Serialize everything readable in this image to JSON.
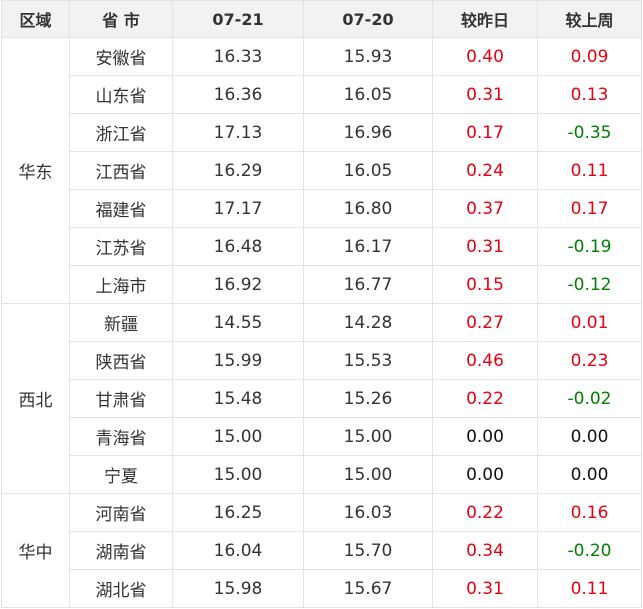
{
  "header": {
    "region": "区域",
    "province": "省 市",
    "date1": "07-21",
    "date2": "07-20",
    "vs_yesterday": "较昨日",
    "vs_last_week": "较上周"
  },
  "regions": [
    {
      "name": "华东",
      "rows": [
        {
          "province": "安徽省",
          "p1": "16.33",
          "p2": "15.93",
          "dd": "0.40",
          "dw": "0.09"
        },
        {
          "province": "山东省",
          "p1": "16.36",
          "p2": "16.05",
          "dd": "0.31",
          "dw": "0.13"
        },
        {
          "province": "浙江省",
          "p1": "17.13",
          "p2": "16.96",
          "dd": "0.17",
          "dw": "-0.35"
        },
        {
          "province": "江西省",
          "p1": "16.29",
          "p2": "16.05",
          "dd": "0.24",
          "dw": "0.11"
        },
        {
          "province": "福建省",
          "p1": "17.17",
          "p2": "16.80",
          "dd": "0.37",
          "dw": "0.17"
        },
        {
          "province": "江苏省",
          "p1": "16.48",
          "p2": "16.17",
          "dd": "0.31",
          "dw": "-0.19"
        },
        {
          "province": "上海市",
          "p1": "16.92",
          "p2": "16.77",
          "dd": "0.15",
          "dw": "-0.12"
        }
      ]
    },
    {
      "name": "西北",
      "rows": [
        {
          "province": "新疆",
          "p1": "14.55",
          "p2": "14.28",
          "dd": "0.27",
          "dw": "0.01"
        },
        {
          "province": "陕西省",
          "p1": "15.99",
          "p2": "15.53",
          "dd": "0.46",
          "dw": "0.23"
        },
        {
          "province": "甘肃省",
          "p1": "15.48",
          "p2": "15.26",
          "dd": "0.22",
          "dw": "-0.02"
        },
        {
          "province": "青海省",
          "p1": "15.00",
          "p2": "15.00",
          "dd": "0.00",
          "dw": "0.00"
        },
        {
          "province": "宁夏",
          "p1": "15.00",
          "p2": "15.00",
          "dd": "0.00",
          "dw": "0.00"
        }
      ]
    },
    {
      "name": "华中",
      "rows": [
        {
          "province": "河南省",
          "p1": "16.25",
          "p2": "16.03",
          "dd": "0.22",
          "dw": "0.16"
        },
        {
          "province": "湖南省",
          "p1": "16.04",
          "p2": "15.70",
          "dd": "0.34",
          "dw": "-0.20"
        },
        {
          "province": "湖北省",
          "p1": "15.98",
          "p2": "15.67",
          "dd": "0.31",
          "dw": "0.11"
        }
      ]
    }
  ],
  "colors": {
    "increase": "#e60012",
    "decrease": "#008000",
    "unchanged": "#111111",
    "header_bg": "#f2f2f2",
    "grid": "#e3e3e3"
  }
}
